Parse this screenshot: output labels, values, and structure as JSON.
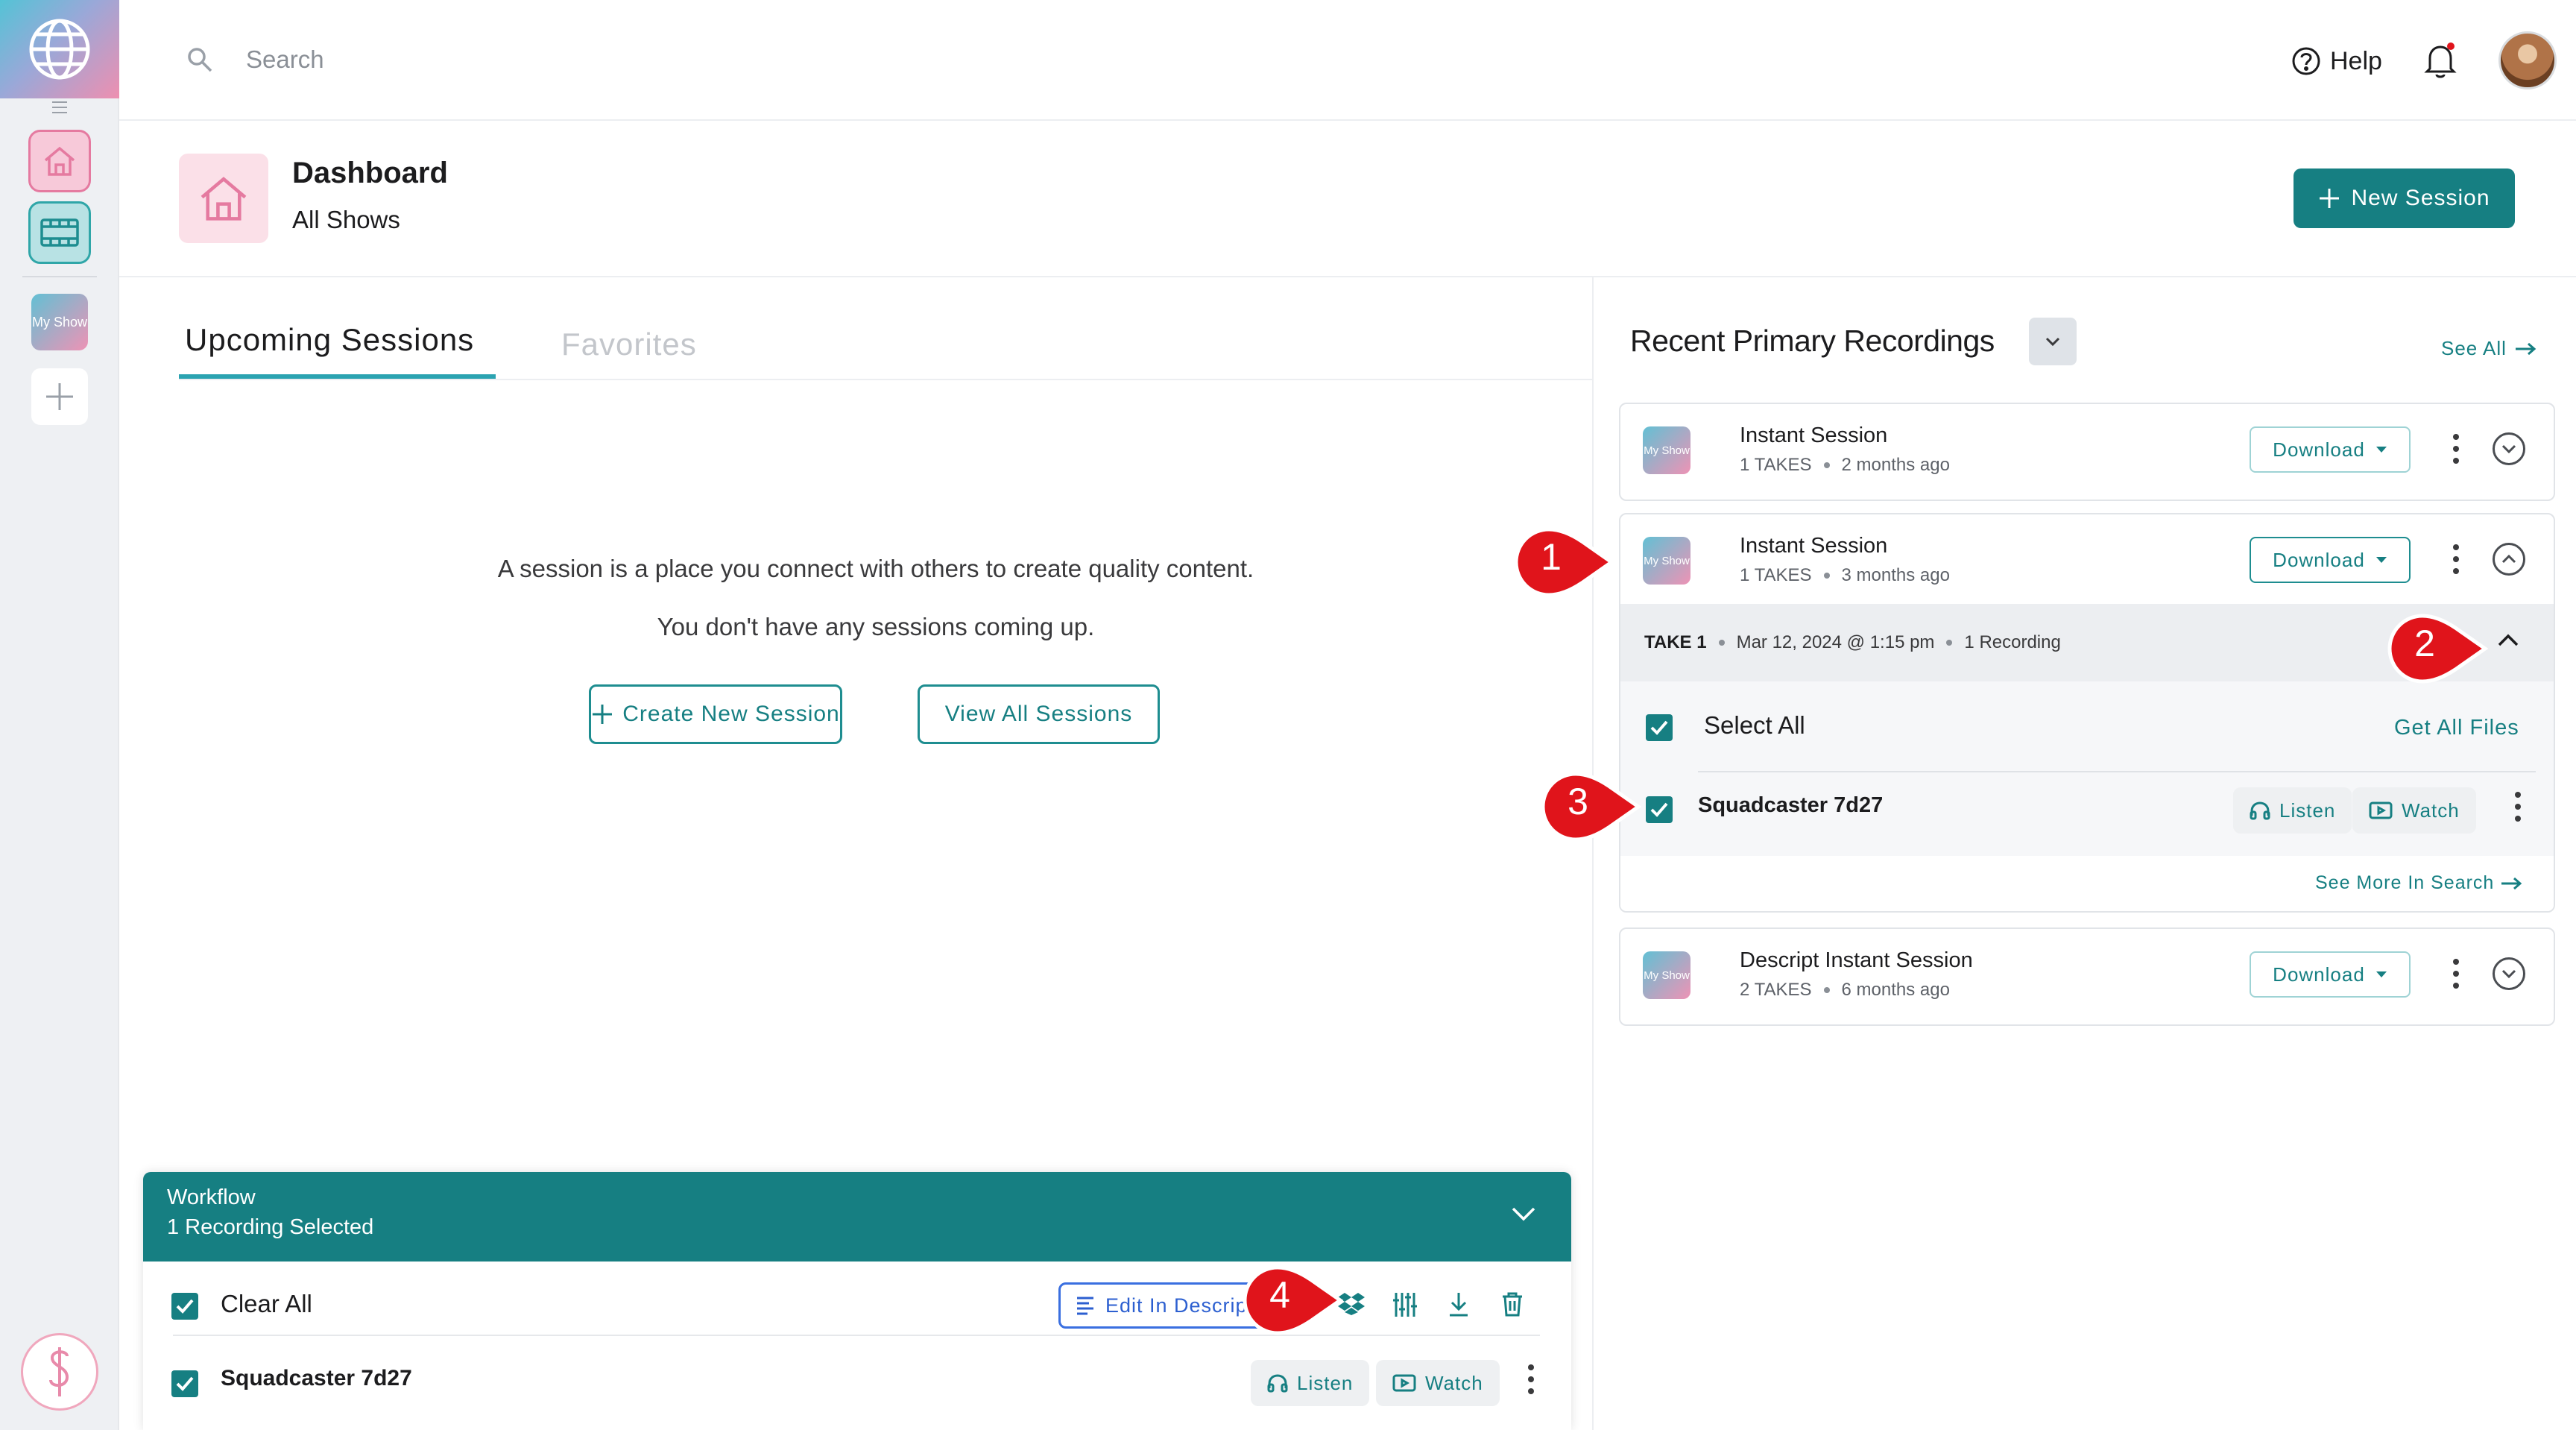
{
  "topbar": {
    "search_placeholder": "Search",
    "help_label": "Help"
  },
  "rail": {
    "show_label": "My Show"
  },
  "header": {
    "title": "Dashboard",
    "subtitle": "All Shows",
    "new_session_label": "New Session"
  },
  "tabs": {
    "upcoming": "Upcoming Sessions",
    "favorites": "Favorites"
  },
  "empty_state": {
    "line1": "A session is a place you connect with others to create quality content.",
    "line2": "You don't have any sessions coming up.",
    "create_label": "Create New Session",
    "view_all_label": "View All Sessions"
  },
  "workflow": {
    "title": "Workflow",
    "subtitle": "1 Recording Selected",
    "clear_all": "Clear All",
    "edit_descript": "Edit In Descript",
    "file_name": "Squadcaster 7d27",
    "listen": "Listen",
    "watch": "Watch"
  },
  "recordings": {
    "title": "Recent Primary Recordings",
    "see_all": "See All",
    "download_label": "Download",
    "thumb_label": "My Show",
    "items": [
      {
        "title": "Instant Session",
        "takes": "1 TAKES",
        "age": "2 months ago"
      },
      {
        "title": "Instant Session",
        "takes": "1 TAKES",
        "age": "3 months ago"
      },
      {
        "title": "Descript Instant Session",
        "takes": "2 TAKES",
        "age": "6 months ago"
      }
    ],
    "take": {
      "label": "TAKE 1",
      "date": "Mar 12, 2024 @ 1:15 pm",
      "count": "1 Recording"
    },
    "select_all": "Select All",
    "get_all_files": "Get All Files",
    "file_name": "Squadcaster 7d27",
    "listen": "Listen",
    "watch": "Watch",
    "see_more": "See More In Search"
  },
  "annotations": [
    "1",
    "2",
    "3",
    "4"
  ],
  "colors": {
    "brand_teal": "#167f82",
    "annotation_red": "#e0141b",
    "descript_blue": "#2c5fd0",
    "pink_accent": "#e57aa0"
  }
}
